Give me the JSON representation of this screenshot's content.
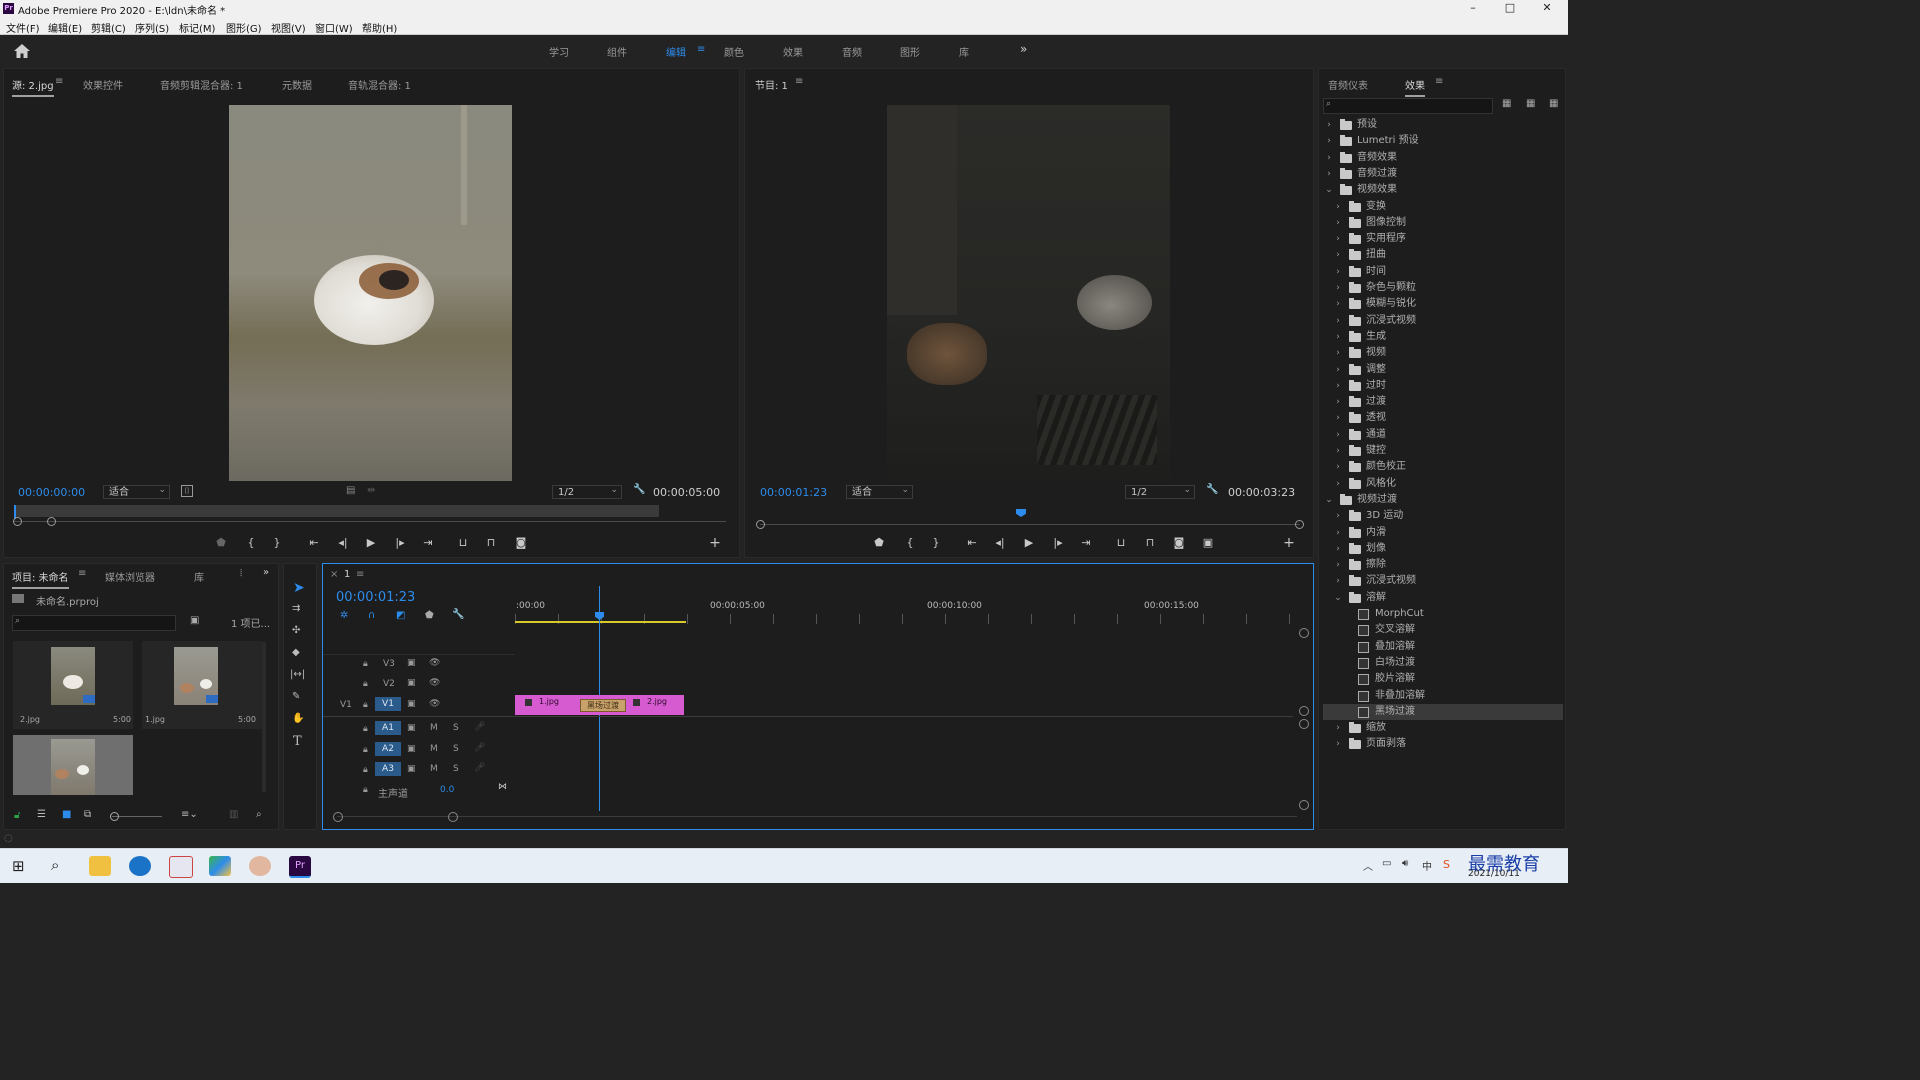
{
  "window": {
    "title": "Adobe Premiere Pro 2020 - E:\\ldn\\未命名 *",
    "app_badge": "Pr",
    "minimize": "–",
    "maximize": "□",
    "close": "✕"
  },
  "menu": [
    "文件(F)",
    "编辑(E)",
    "剪辑(C)",
    "序列(S)",
    "标记(M)",
    "图形(G)",
    "视图(V)",
    "窗口(W)",
    "帮助(H)"
  ],
  "workspaces": [
    "学习",
    "组件",
    "编辑",
    "颜色",
    "效果",
    "音频",
    "图形",
    "库"
  ],
  "workspace_more": "»",
  "source_panel": {
    "tabs": [
      "源: 2.jpg",
      "效果控件",
      "音频剪辑混合器: 1",
      "元数据",
      "音轨混合器: 1"
    ],
    "timecode": "00:00:00:00",
    "fit": "适合",
    "resolution": "1/2",
    "duration": "00:00:05:00"
  },
  "program_panel": {
    "tab": "节目: 1",
    "timecode": "00:00:01:23",
    "fit": "适合",
    "resolution": "1/2",
    "duration": "00:00:03:23"
  },
  "project_panel": {
    "tabs": [
      "项目: 未命名",
      "媒体浏览器",
      "库"
    ],
    "project_file": "未命名.prproj",
    "item_count": "1 项已...",
    "items": [
      {
        "name": "2.jpg",
        "duration": "5:00"
      },
      {
        "name": "1.jpg",
        "duration": "5:00"
      }
    ]
  },
  "timeline": {
    "tab": "1",
    "timecode": "00:00:01:23",
    "ruler": [
      ":00:00",
      "00:00:05:00",
      "00:00:10:00",
      "00:00:15:00"
    ],
    "video_tracks": [
      "V3",
      "V2",
      "V1"
    ],
    "audio_tracks": [
      "A1",
      "A2",
      "A3"
    ],
    "source_patch": "V1",
    "master": {
      "label": "主声道",
      "value": "0.0"
    },
    "clips": [
      {
        "name": "1.jpg"
      },
      {
        "name": "黑场过渡"
      },
      {
        "name": "2.jpg"
      }
    ],
    "mute": "M",
    "solo": "S"
  },
  "effects_panel": {
    "tabs": [
      "音频仪表",
      "效果"
    ],
    "tree": [
      {
        "label": "预设",
        "level": 0,
        "type": "folder",
        "open": false
      },
      {
        "label": "Lumetri 预设",
        "level": 0,
        "type": "folder",
        "open": false
      },
      {
        "label": "音频效果",
        "level": 0,
        "type": "folder",
        "open": false
      },
      {
        "label": "音频过渡",
        "level": 0,
        "type": "folder",
        "open": false
      },
      {
        "label": "视频效果",
        "level": 0,
        "type": "folder",
        "open": true
      },
      {
        "label": "变换",
        "level": 1,
        "type": "folder",
        "open": false
      },
      {
        "label": "图像控制",
        "level": 1,
        "type": "folder",
        "open": false
      },
      {
        "label": "实用程序",
        "level": 1,
        "type": "folder",
        "open": false
      },
      {
        "label": "扭曲",
        "level": 1,
        "type": "folder",
        "open": false
      },
      {
        "label": "时间",
        "level": 1,
        "type": "folder",
        "open": false
      },
      {
        "label": "杂色与颗粒",
        "level": 1,
        "type": "folder",
        "open": false
      },
      {
        "label": "模糊与锐化",
        "level": 1,
        "type": "folder",
        "open": false
      },
      {
        "label": "沉浸式视频",
        "level": 1,
        "type": "folder",
        "open": false
      },
      {
        "label": "生成",
        "level": 1,
        "type": "folder",
        "open": false
      },
      {
        "label": "视频",
        "level": 1,
        "type": "folder",
        "open": false
      },
      {
        "label": "调整",
        "level": 1,
        "type": "folder",
        "open": false
      },
      {
        "label": "过时",
        "level": 1,
        "type": "folder",
        "open": false
      },
      {
        "label": "过渡",
        "level": 1,
        "type": "folder",
        "open": false
      },
      {
        "label": "透视",
        "level": 1,
        "type": "folder",
        "open": false
      },
      {
        "label": "通道",
        "level": 1,
        "type": "folder",
        "open": false
      },
      {
        "label": "键控",
        "level": 1,
        "type": "folder",
        "open": false
      },
      {
        "label": "颜色校正",
        "level": 1,
        "type": "folder",
        "open": false
      },
      {
        "label": "风格化",
        "level": 1,
        "type": "folder",
        "open": false
      },
      {
        "label": "视频过渡",
        "level": 0,
        "type": "folder",
        "open": true
      },
      {
        "label": "3D 运动",
        "level": 1,
        "type": "folder",
        "open": false
      },
      {
        "label": "内滑",
        "level": 1,
        "type": "folder",
        "open": false
      },
      {
        "label": "划像",
        "level": 1,
        "type": "folder",
        "open": false
      },
      {
        "label": "擦除",
        "level": 1,
        "type": "folder",
        "open": false
      },
      {
        "label": "沉浸式视频",
        "level": 1,
        "type": "folder",
        "open": false
      },
      {
        "label": "溶解",
        "level": 1,
        "type": "folder",
        "open": true
      },
      {
        "label": "MorphCut",
        "level": 2,
        "type": "effect"
      },
      {
        "label": "交叉溶解",
        "level": 2,
        "type": "effect"
      },
      {
        "label": "叠加溶解",
        "level": 2,
        "type": "effect"
      },
      {
        "label": "白场过渡",
        "level": 2,
        "type": "effect"
      },
      {
        "label": "胶片溶解",
        "level": 2,
        "type": "effect"
      },
      {
        "label": "非叠加溶解",
        "level": 2,
        "type": "effect"
      },
      {
        "label": "黑场过渡",
        "level": 2,
        "type": "effect",
        "selected": true
      },
      {
        "label": "缩放",
        "level": 1,
        "type": "folder",
        "open": false
      },
      {
        "label": "页面剥落",
        "level": 1,
        "type": "folder",
        "open": false
      }
    ]
  },
  "taskbar": {
    "date": "2021/10/11",
    "watermark": "最需教育",
    "ime": "中"
  },
  "colors": {
    "accent": "#2d8ceb",
    "clip_pink": "#d75bd0",
    "playhead": "#2d8ceb",
    "transition": "#c9a26b"
  }
}
